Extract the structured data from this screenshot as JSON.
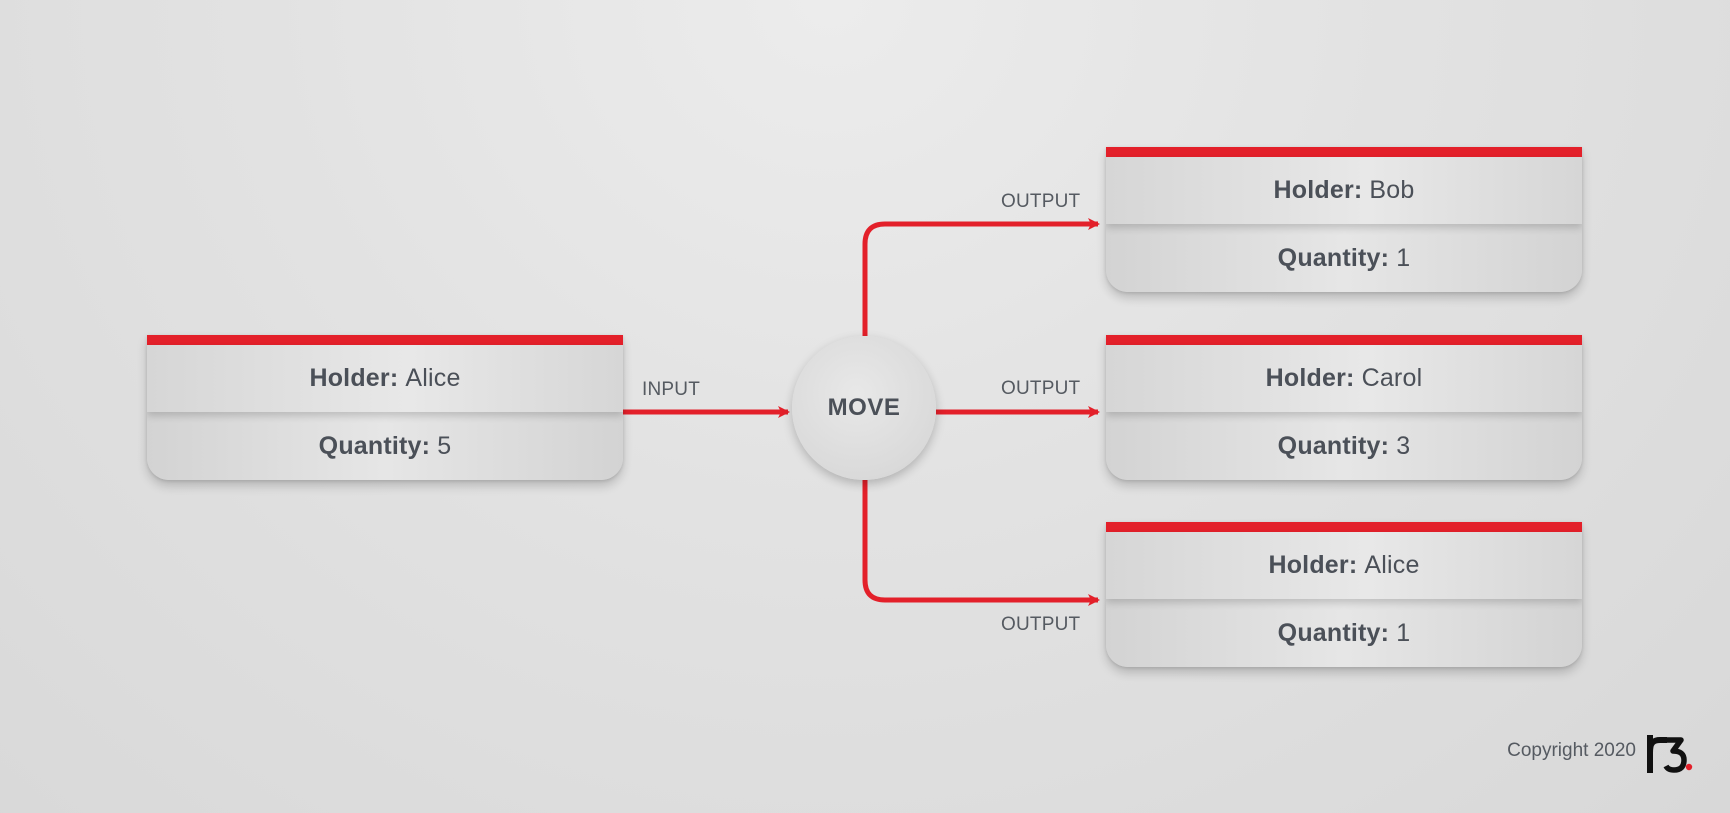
{
  "diagram": {
    "input_state": {
      "holder_label": "Holder:",
      "holder_value": "Alice",
      "quantity_label": "Quantity:",
      "quantity_value": "5"
    },
    "command": "MOVE",
    "input_edge_label": "INPUT",
    "outputs": [
      {
        "edge_label": "OUTPUT",
        "holder_label": "Holder:",
        "holder_value": "Bob",
        "quantity_label": "Quantity:",
        "quantity_value": "1"
      },
      {
        "edge_label": "OUTPUT",
        "holder_label": "Holder:",
        "holder_value": "Carol",
        "quantity_label": "Quantity:",
        "quantity_value": "3"
      },
      {
        "edge_label": "OUTPUT",
        "holder_label": "Holder:",
        "holder_value": "Alice",
        "quantity_label": "Quantity:",
        "quantity_value": "1"
      }
    ]
  },
  "footer": {
    "copyright": "Copyright 2020",
    "logo_text": "r3"
  },
  "colors": {
    "accent": "#e3202a",
    "text": "#4b5058",
    "background": "#e2e2e2"
  }
}
